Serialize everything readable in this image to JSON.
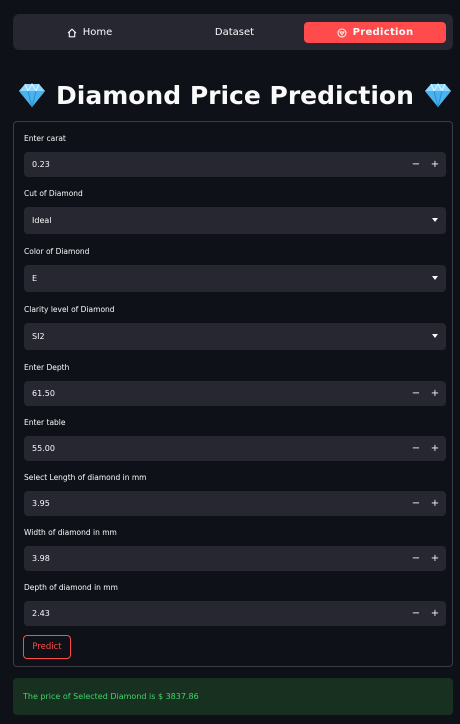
{
  "nav": {
    "items": [
      {
        "label": "Home",
        "icon": "home-icon"
      },
      {
        "label": "Dataset"
      },
      {
        "label": "Prediction",
        "icon": "gem-outline-icon"
      }
    ],
    "active": "Prediction",
    "accent": "#ff4b4b"
  },
  "title": "Diamond Price Prediction",
  "title_icon": "diamond-emoji",
  "form": {
    "carat": {
      "label": "Enter carat",
      "value": "0.23"
    },
    "cut": {
      "label": "Cut of Diamond",
      "value": "Ideal"
    },
    "color": {
      "label": "Color of Diamond",
      "value": "E"
    },
    "clarity": {
      "label": "Clarity level of Diamond",
      "value": "SI2"
    },
    "depth": {
      "label": "Enter Depth",
      "value": "61.50"
    },
    "table": {
      "label": "Enter table",
      "value": "55.00"
    },
    "length": {
      "label": "Select Length of diamond in mm",
      "value": "3.95"
    },
    "width": {
      "label": "Width of diamond in mm",
      "value": "3.98"
    },
    "depth_mm": {
      "label": "Depth of diamond in mm",
      "value": "2.43"
    },
    "stepper_minus": "−",
    "stepper_plus": "+",
    "predict_label": "Predict"
  },
  "result": {
    "text": "The price of Selected Diamond is $ 3837.86",
    "color": "#3dd56d"
  }
}
